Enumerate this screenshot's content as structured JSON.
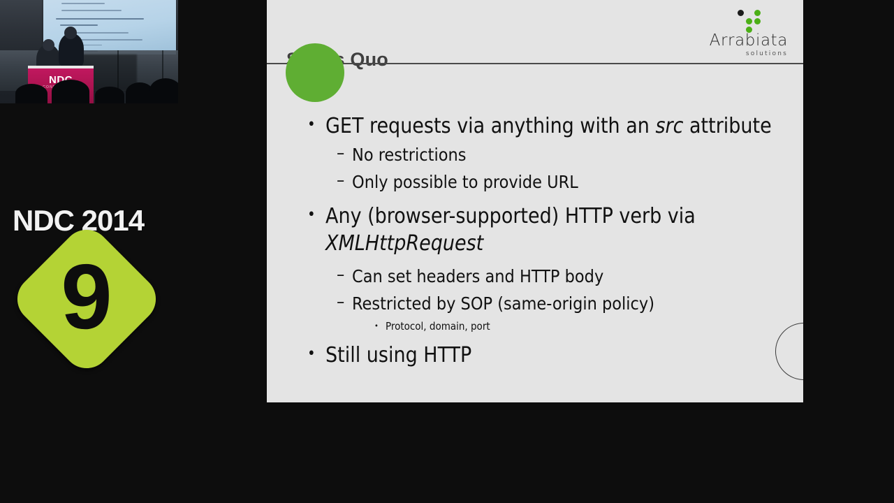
{
  "video_thumbnail": {
    "name": "conference-talk-video-thumbnail",
    "podium_label": "NDC",
    "podium_sublabel": "CONFERENCES",
    "description": "Speaker at podium in front of projected slide"
  },
  "conference_logo": {
    "wordmark": "NDC 2014",
    "badge_number": "9",
    "badge_color": "#b4d335"
  },
  "slide": {
    "title": "Status Quo",
    "background_color": "#e4e4e4",
    "accent_color": "#5fae33",
    "rule_color": "#4a4a4a",
    "bullets": [
      {
        "level": 1,
        "marker": "•",
        "text_before": "GET requests via anything with an ",
        "italic": "src",
        "text_after": " attribute"
      },
      {
        "level": 2,
        "marker": "–",
        "text_before": "No restrictions",
        "italic": "",
        "text_after": ""
      },
      {
        "level": 2,
        "marker": "–",
        "text_before": "Only possible to provide URL",
        "italic": "",
        "text_after": ""
      },
      {
        "level": 1,
        "marker": "•",
        "text_before": "Any (browser-supported) HTTP verb via ",
        "italic": "XMLHttpRequest",
        "text_after": ""
      },
      {
        "level": 2,
        "marker": "–",
        "text_before": "Can set headers and HTTP body",
        "italic": "",
        "text_after": ""
      },
      {
        "level": 2,
        "marker": "–",
        "text_before": "Restricted by SOP (same-origin policy)",
        "italic": "",
        "text_after": ""
      },
      {
        "level": 3,
        "marker": "•",
        "text_before": "Protocol, domain, port",
        "italic": "",
        "text_after": ""
      },
      {
        "level": 1,
        "marker": "•",
        "text_before": "Still using HTTP",
        "italic": "",
        "text_after": ""
      }
    ]
  },
  "brand_logo": {
    "name": "Arrabiata",
    "subtitle": "solutions",
    "dot_color": "#4caf17",
    "dark_dot_color": "#1b1b1b"
  }
}
